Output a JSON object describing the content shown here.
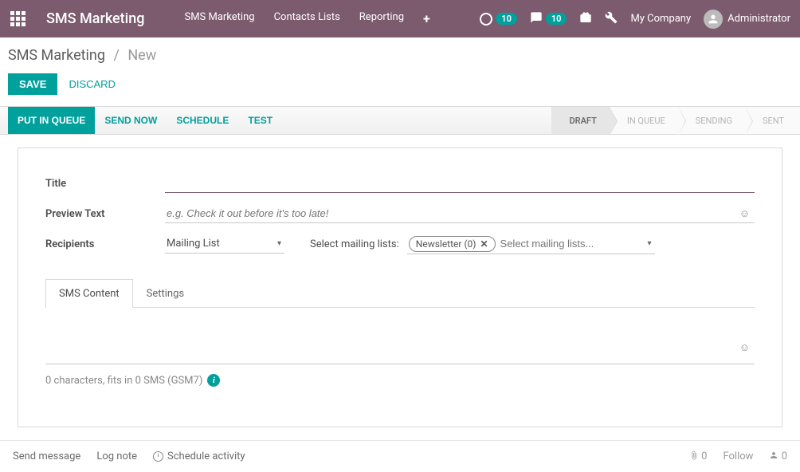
{
  "topbar": {
    "brand": "SMS Marketing",
    "nav": [
      "SMS Marketing",
      "Contacts Lists",
      "Reporting"
    ],
    "badge1": "10",
    "badge2": "10",
    "company": "My Company",
    "user": "Administrator"
  },
  "breadcrumb": {
    "app": "SMS Marketing",
    "current": "New"
  },
  "actions": {
    "save": "SAVE",
    "discard": "DISCARD"
  },
  "statusbar": {
    "put_in_queue": "PUT IN QUEUE",
    "send_now": "SEND NOW",
    "schedule": "SCHEDULE",
    "test": "TEST",
    "stages": [
      "DRAFT",
      "IN QUEUE",
      "SENDING",
      "SENT"
    ]
  },
  "form": {
    "title_label": "Title",
    "title_value": "",
    "preview_label": "Preview Text",
    "preview_placeholder": "e.g. Check it out before it's too late!",
    "preview_value": "",
    "recipients_label": "Recipients",
    "recipients_type": "Mailing List",
    "select_lists_label": "Select mailing lists:",
    "selected_tag": "Newsletter (0)",
    "select_lists_placeholder": "Select mailing lists..."
  },
  "tabs": {
    "sms_content": "SMS Content",
    "settings": "Settings"
  },
  "sms": {
    "counter": "0 characters, fits in 0 SMS (GSM7)",
    "info_tooltip": "i"
  },
  "chatter": {
    "send_message": "Send message",
    "log_note": "Log note",
    "schedule_activity": "Schedule activity",
    "attachments": "0",
    "follow": "Follow",
    "followers": "0"
  }
}
